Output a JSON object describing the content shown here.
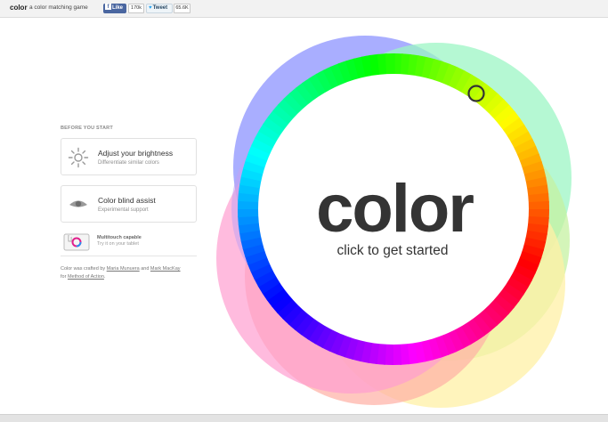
{
  "header": {
    "brand": "color",
    "tagline": "a color matching game",
    "like_label": "Like",
    "like_count": "170k",
    "tweet_label": "Tweet",
    "tweet_count": "65.6K"
  },
  "panel": {
    "section_title": "BEFORE YOU START",
    "brightness": {
      "title": "Adjust your brightness",
      "subtitle": "Differentiate similar colors",
      "icon": "sun-icon"
    },
    "colorblind": {
      "title": "Color blind assist",
      "subtitle": "Experimental support",
      "icon": "eye-icon"
    },
    "multitouch": {
      "title": "Multitouch capable",
      "subtitle": "Try it on your tablet",
      "icon": "tablet-icon"
    },
    "credits": {
      "prefix": "Color was crafted by",
      "author1": "Maria Munuera",
      "and": "and",
      "author2": "Mark MacKay",
      "for": "for",
      "studio": "Method of Action",
      "suffix": "."
    }
  },
  "wheel": {
    "word": "color",
    "cta": "click to get started",
    "colors": [
      "#ff0000",
      "#ffff00",
      "#00ff00",
      "#00ffff",
      "#0000ff",
      "#ff00ff"
    ],
    "bg_colors": [
      "#9aa0ff",
      "#9cf5c4",
      "#c6f2a2",
      "#fff0a6",
      "#ffb1a6",
      "#ff9ed0",
      "#c3a3f2"
    ]
  }
}
